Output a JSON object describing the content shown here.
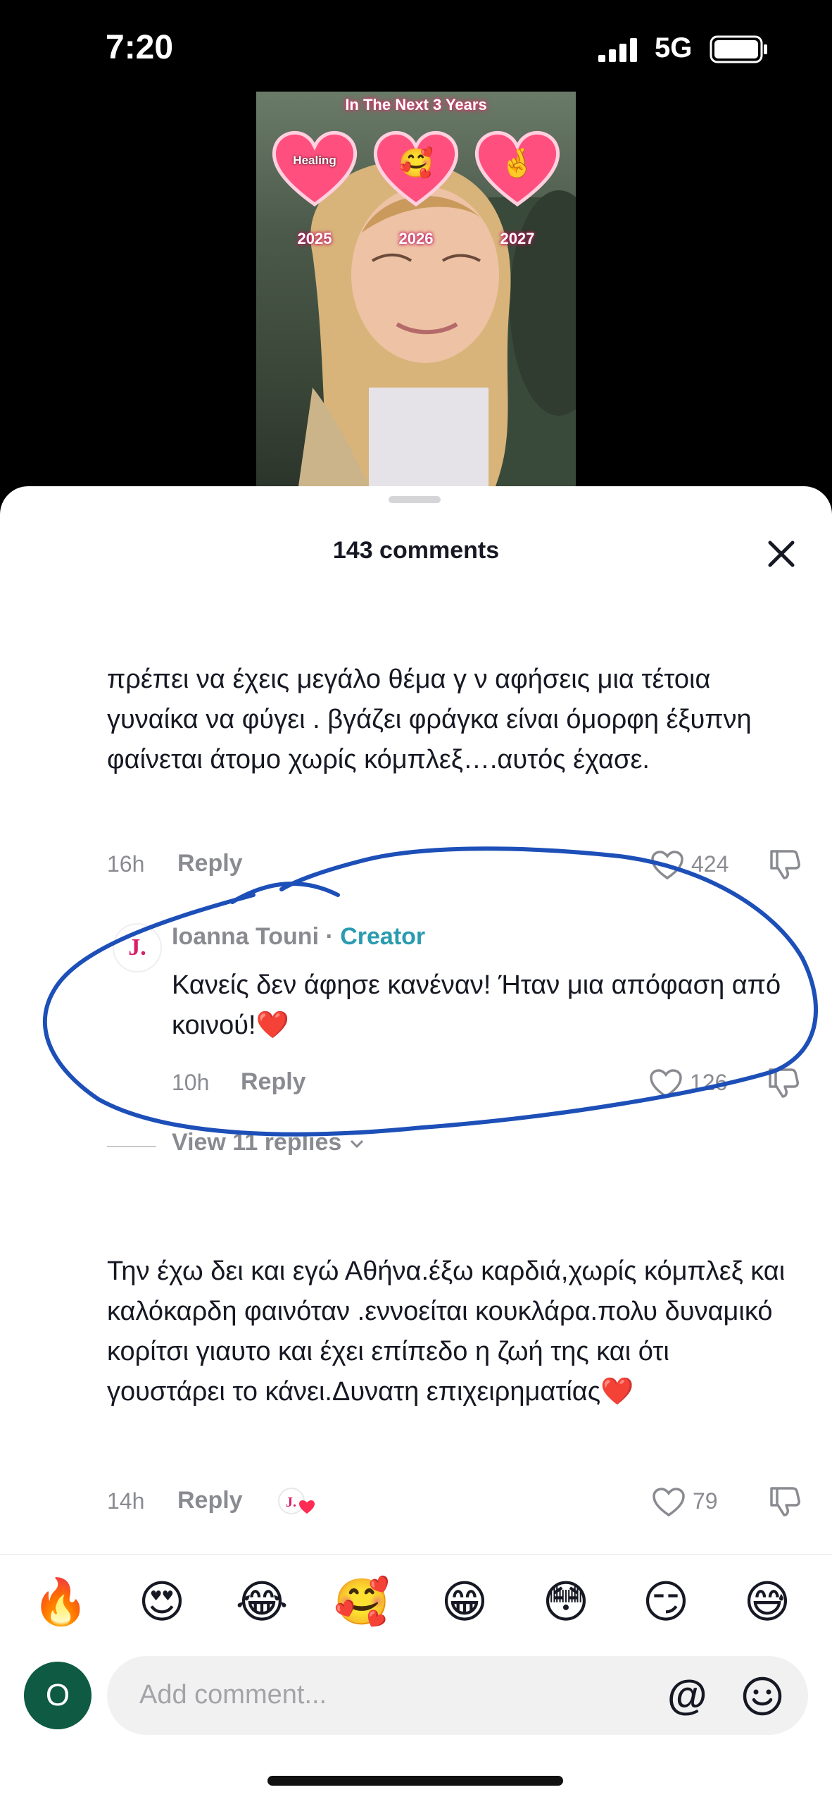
{
  "status_bar": {
    "time": "7:20",
    "network": "5G"
  },
  "video": {
    "overlay_title": "In The Next 3 Years",
    "hearts": [
      {
        "label": "Healing",
        "emoji": "",
        "year": "2025"
      },
      {
        "label": "",
        "emoji": "🥰",
        "year": "2026"
      },
      {
        "label": "",
        "emoji": "🤞",
        "year": "2027"
      }
    ]
  },
  "sheet": {
    "title": "143 comments"
  },
  "comments": [
    {
      "text": "πρέπει να έχεις μεγάλο θέμα γ ν αφήσεις μια τέτοια γυναίκα να φύγει . βγάζει φράγκα είναι όμορφη έξυπνη φαίνεται άτομο χωρίς κόμπλεξ….αυτός έχασε.",
      "time": "16h",
      "reply_label": "Reply",
      "likes": "424"
    },
    {
      "author": "Ioanna Touni",
      "separator": " · ",
      "badge": "Creator",
      "avatar_letter": "J.",
      "text": "Κανείς δεν άφησε κανέναν! Ήταν μια απόφαση από κοινού!❤️",
      "time": "10h",
      "reply_label": "Reply",
      "likes": "126"
    },
    {
      "text": "Την έχω δει και εγώ Αθήνα.έξω καρδιά,χωρίς κόμπλεξ και καλόκαρδη φαινόταν .εννοείται κουκλάρα.πολυ δυναμικό κορίτσι γιαυτο και έχει επίπεδο η ζωή της και ότι γουστάρει το κάνει.Δυνατη επιχειρηματίας❤️",
      "time": "14h",
      "reply_label": "Reply",
      "likes": "79"
    }
  ],
  "view_replies": "View 11 replies",
  "emoji_bar": [
    "🔥",
    "😍",
    "😂",
    "🥰",
    "😁",
    "😳",
    "😏",
    "😅"
  ],
  "input": {
    "avatar_letter": "O",
    "placeholder": "Add comment..."
  },
  "colors": {
    "accent_creator": "#2a9bb0",
    "scribble": "#1d4fb8",
    "avatar_bg": "#0e5a43"
  }
}
